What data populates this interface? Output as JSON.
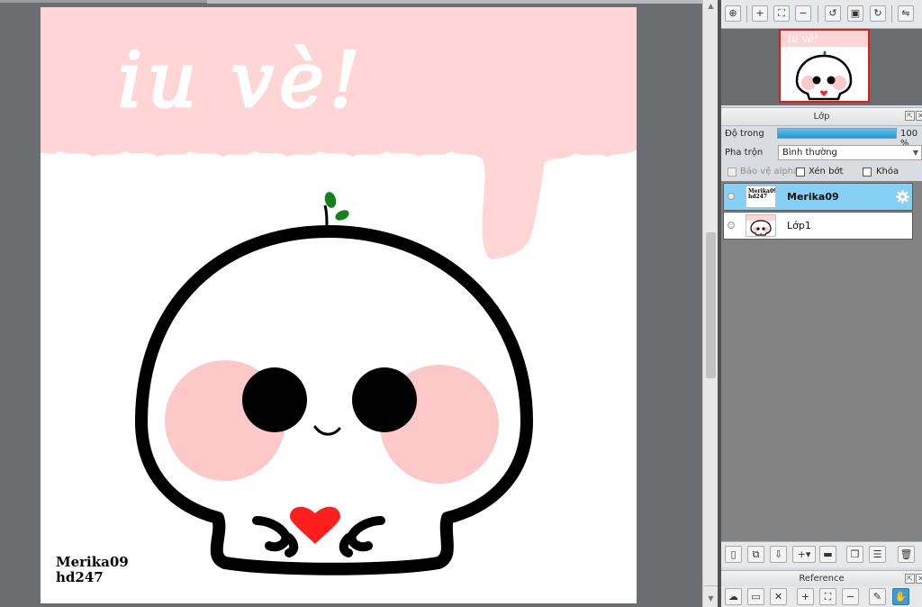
{
  "artwork": {
    "banner_text": "iu vè!",
    "signature_line1": "Merika09",
    "signature_line2": "hd247",
    "colors": {
      "pink": "#ffd5d5",
      "cheek": "#fcc8c8",
      "outline": "#000000",
      "heart": "#ff1e1e",
      "sprout": "#11821e"
    }
  },
  "navigator": {
    "toolbar_icons": [
      "zoom-actual-icon",
      "zoom-in-icon",
      "fit-icon",
      "zoom-out-icon",
      "rotate-left-icon",
      "fullscreen-icon",
      "rotate-right-icon",
      "flip-icon"
    ]
  },
  "layer_panel": {
    "title": "Lớp",
    "opacity_label": "Độ trong",
    "opacity_value": "100 %",
    "opacity_fraction": 1.0,
    "blend_label": "Pha trộn",
    "blend_value": "Bình thường",
    "protect_alpha_label": "Bảo vệ alpha",
    "clipping_label": "Xén bớt",
    "lock_label": "Khóa",
    "layers": [
      {
        "name": "Merika09",
        "thumb_text": "Merika09 hd247",
        "selected": true
      },
      {
        "name": "Lớp1",
        "selected": false
      }
    ]
  },
  "reference_panel": {
    "title": "Reference"
  }
}
